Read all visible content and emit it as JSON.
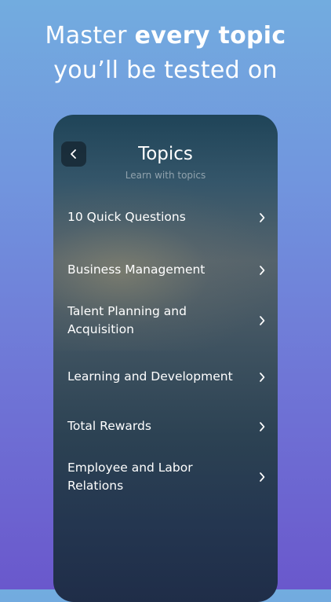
{
  "headline": {
    "line1_regular": "Master ",
    "line1_bold": "every topic",
    "line2": "you’ll be tested on"
  },
  "screen": {
    "title": "Topics",
    "subtitle": "Learn with topics",
    "back_icon": "chevron-left-icon"
  },
  "topics": [
    {
      "label": "10 Quick Questions"
    },
    {
      "label": "Business Management"
    },
    {
      "label": "Talent Planning and Acquisition"
    },
    {
      "label": "Learning and Development"
    },
    {
      "label": "Total Rewards"
    },
    {
      "label": "Employee and Labor Relations"
    }
  ],
  "colors": {
    "background_top": "#72acdf",
    "background_bottom": "#6a58cc",
    "text": "#ffffff"
  }
}
